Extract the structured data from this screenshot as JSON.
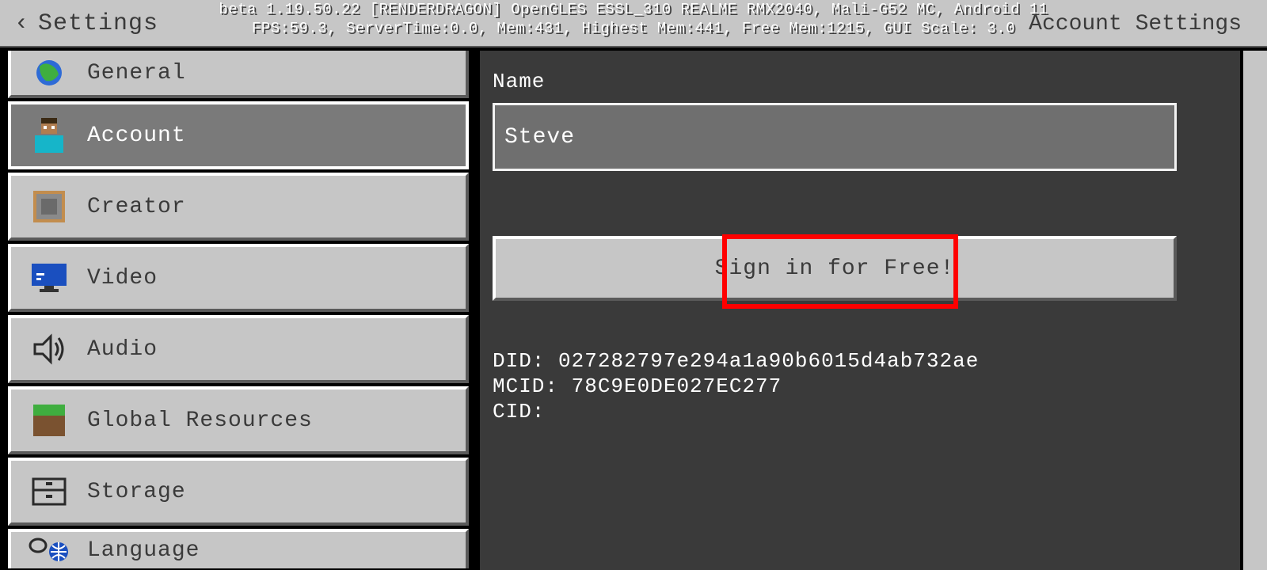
{
  "header": {
    "back_label": "Settings",
    "debug_line1": "beta 1.19.50.22 [RENDERDRAGON] OpenGLES ESSL_310 REALME RMX2040, Mali-G52 MC, Android 11",
    "debug_line2": "FPS:59.3, ServerTime:0.0, Mem:431, Highest Mem:441, Free Mem:1215, GUI Scale: 3.0",
    "reset_label": "Account Settings"
  },
  "sidebar": {
    "items": [
      {
        "label": "General"
      },
      {
        "label": "Account"
      },
      {
        "label": "Creator"
      },
      {
        "label": "Video"
      },
      {
        "label": "Audio"
      },
      {
        "label": "Global Resources"
      },
      {
        "label": "Storage"
      },
      {
        "label": "Language"
      }
    ]
  },
  "content": {
    "name_label": "Name",
    "name_value": "Steve",
    "signin_label": "Sign in for Free!",
    "did_label": "DID:",
    "did_value": "027282797e294a1a90b6015d4ab732ae",
    "mcid_label": "MCID:",
    "mcid_value": "78C9E0DE027EC277",
    "cid_label": "CID:",
    "cid_value": ""
  }
}
